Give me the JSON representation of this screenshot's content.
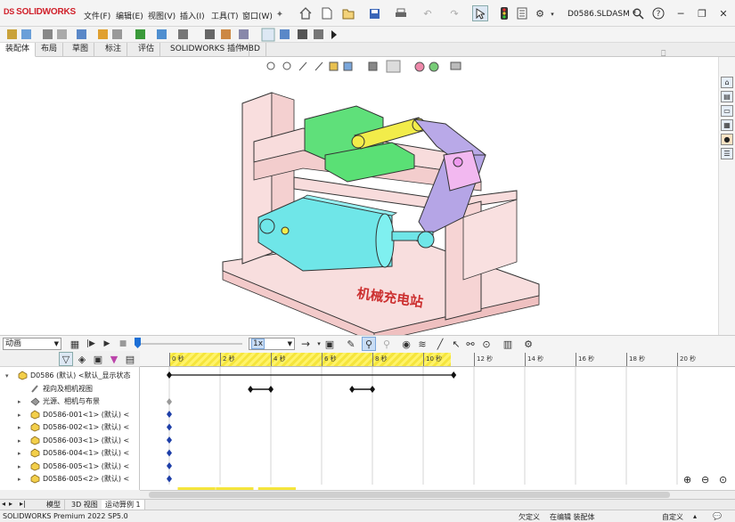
{
  "app": {
    "logo_text": "SOLIDWORKS",
    "logo_mark": "DS",
    "document_name": "D0586.SLDASM *"
  },
  "menu": [
    {
      "label": "文件(F)"
    },
    {
      "label": "编辑(E)"
    },
    {
      "label": "视图(V)"
    },
    {
      "label": "插入(I)"
    },
    {
      "label": "工具(T)"
    },
    {
      "label": "窗口(W)"
    }
  ],
  "command_tabs": [
    {
      "label": "装配体",
      "active": true
    },
    {
      "label": "布局",
      "active": false
    },
    {
      "label": "草图",
      "active": false
    },
    {
      "label": "标注",
      "active": false
    },
    {
      "label": "评估",
      "active": false
    },
    {
      "label": "SOLIDWORKS 插件",
      "active": false
    },
    {
      "label": "MBD",
      "active": false
    }
  ],
  "viewport": {
    "watermark": "机械充电站"
  },
  "motion": {
    "study_type": "动画",
    "playback_speed": "1x"
  },
  "tree": {
    "items": [
      {
        "label": "D0586 (默认) <默认_显示状态",
        "icon": "assembly-icon",
        "indent": 0
      },
      {
        "label": "视向及相机视图",
        "icon": "camera-icon",
        "indent": 1
      },
      {
        "label": "光源、相机与布景",
        "icon": "lights-icon",
        "indent": 1
      },
      {
        "label": "D0586-001<1> (默认) <",
        "icon": "part-icon",
        "indent": 1
      },
      {
        "label": "D0586-002<1> (默认) <",
        "icon": "part-icon",
        "indent": 1
      },
      {
        "label": "D0586-003<1> (默认) <",
        "icon": "part-icon",
        "indent": 1
      },
      {
        "label": "D0586-004<1> (默认) <",
        "icon": "part-icon",
        "indent": 1
      },
      {
        "label": "D0586-005<1> (默认) <",
        "icon": "part-icon",
        "indent": 1
      },
      {
        "label": "D0586-005<2> (默认) <",
        "icon": "part-icon",
        "indent": 1
      }
    ]
  },
  "timeline": {
    "ticks": [
      "0 秒",
      "2 秒",
      "4 秒",
      "6 秒",
      "8 秒",
      "10 秒",
      "12 秒",
      "14 秒",
      "16 秒",
      "18 秒",
      "20 秒"
    ]
  },
  "bottom_tabs": [
    {
      "label": "模型",
      "active": false
    },
    {
      "label": "3D 视图",
      "active": false
    },
    {
      "label": "运动算例 1",
      "active": true
    }
  ],
  "status": {
    "product": "SOLIDWORKS Premium 2022 SP5.0",
    "defined": "欠定义",
    "editing": "在编辑 装配体",
    "custom": "自定义"
  },
  "colors": {
    "timeline_yellow": "#f5e53c",
    "key_blue": "#1e3fa8",
    "accent_blue": "#1c6fd6",
    "brand_red": "#d0202a"
  }
}
